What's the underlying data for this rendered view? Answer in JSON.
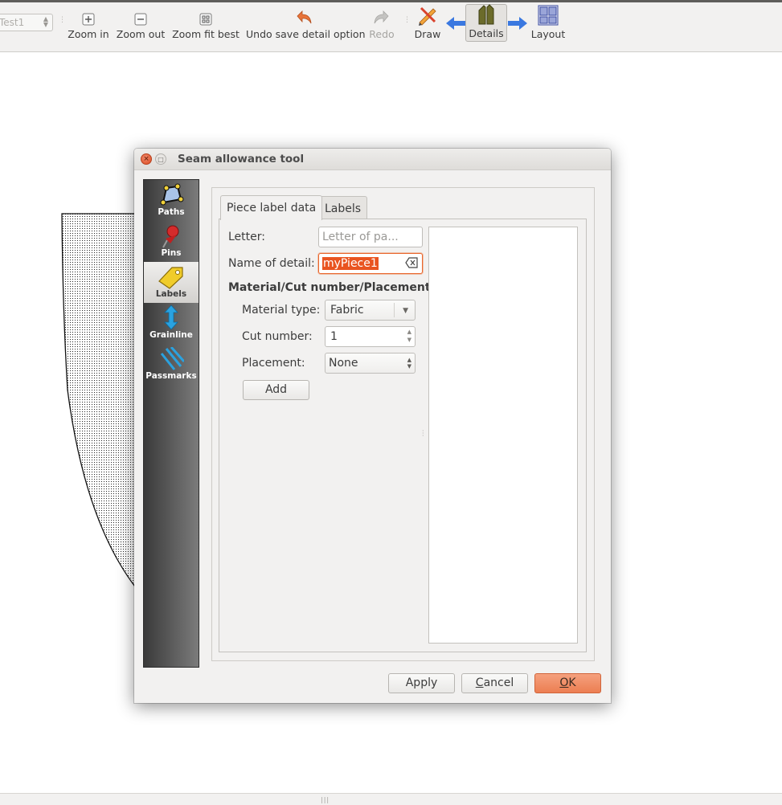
{
  "toolbar": {
    "pattern_combo": "Test1",
    "buttons": [
      {
        "label": "Zoom in",
        "icon": "zoom-in-icon"
      },
      {
        "label": "Zoom out",
        "icon": "zoom-out-icon"
      },
      {
        "label": "Zoom fit best",
        "icon": "zoom-fit-best-icon"
      },
      {
        "label": "Undo save detail option",
        "icon": "undo-icon"
      },
      {
        "label": "Redo",
        "icon": "redo-icon",
        "disabled": true
      }
    ],
    "modes": [
      {
        "label": "Draw",
        "icon": "draw-pencil-icon"
      },
      {
        "label": "Details",
        "icon": "details-icon",
        "active": true
      },
      {
        "label": "Layout",
        "icon": "layout-icon"
      }
    ]
  },
  "dialog": {
    "title": "Seam allowance tool",
    "sidebar": [
      {
        "label": "Paths",
        "icon": "paths-icon"
      },
      {
        "label": "Pins",
        "icon": "pin-icon"
      },
      {
        "label": "Labels",
        "icon": "label-tag-icon",
        "active": true
      },
      {
        "label": "Grainline",
        "icon": "grainline-arrow-icon"
      },
      {
        "label": "Passmarks",
        "icon": "passmarks-icon"
      }
    ],
    "tabs": [
      {
        "label": "Piece label data",
        "active": true
      },
      {
        "label": "Labels"
      }
    ],
    "form": {
      "letter_label": "Letter:",
      "letter_placeholder": "Letter of pa...",
      "name_label": "Name of detail:",
      "name_value": "myPiece1",
      "section_title": "Material/Cut number/Placement",
      "material_label": "Material type:",
      "material_value": "Fabric",
      "cut_label": "Cut number:",
      "cut_value": "1",
      "placement_label": "Placement:",
      "placement_value": "None",
      "add_button": "Add"
    },
    "buttons": {
      "apply": "Apply",
      "cancel_first": "C",
      "cancel_rest": "ancel",
      "ok_first": "O",
      "ok_rest": "K"
    }
  },
  "colors": {
    "accent": "#e95420",
    "ok_button": "#ec7e52",
    "sidebar_dark": "#3a3a3a",
    "arrow_blue": "#3a78e0"
  }
}
